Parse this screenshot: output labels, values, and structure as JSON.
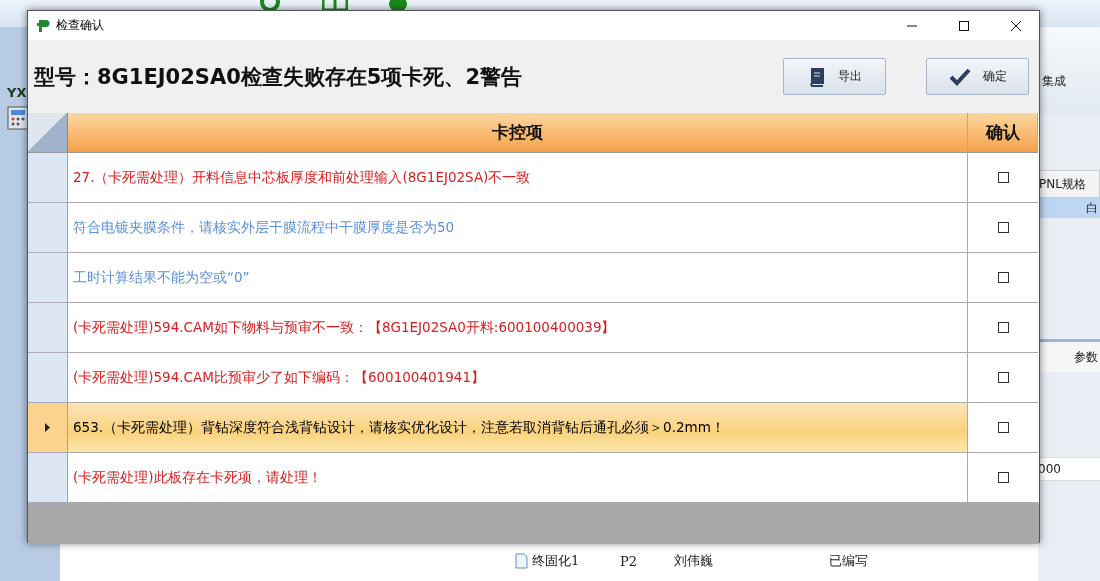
{
  "background": {
    "side_label": "YX",
    "ribbon_button": "集成",
    "column_header": "PNL规格",
    "cell_1": "白",
    "param_header": "参数",
    "cell_2": "000",
    "tree_rows": [
      {
        "name": "终固化1",
        "col_2": "P2",
        "col_3": "刘伟巍",
        "col_4": "已编写"
      }
    ]
  },
  "dialog": {
    "title": "检查确认",
    "heading": "型号：8G1EJ02SA0检查失败存在5项卡死、2警告",
    "buttons": [
      {
        "label": "导出",
        "kind": "export"
      },
      {
        "label": "确定",
        "kind": "confirm"
      }
    ],
    "columns": [
      "卡控项",
      "确认"
    ],
    "rows": [
      {
        "text": "27.（卡死需处理）开料信息中芯板厚度和前处理输入(8G1EJ02SA)不一致",
        "color": "#d42020",
        "selected": false,
        "checked": false
      },
      {
        "text": "符合电镀夹膜条件，请核实外层干膜流程中干膜厚度是否为50",
        "color": "#5b8fd6",
        "selected": false,
        "checked": false
      },
      {
        "text": "工时计算结果不能为空或“0”",
        "color": "#5b8fd6",
        "selected": false,
        "checked": false
      },
      {
        "text": "(卡死需处理)594.CAM如下物料与预审不一致：【8G1EJ02SA0开料:600100400039】",
        "color": "#d42020",
        "selected": false,
        "checked": false
      },
      {
        "text": "(卡死需处理)594.CAM比预审少了如下编码：【600100401941】",
        "color": "#d42020",
        "selected": false,
        "checked": false
      },
      {
        "text": "653.（卡死需处理）背钻深度符合浅背钻设计，请核实优化设计，注意若取消背钻后通孔必须＞0.2mm！",
        "color": "#000000",
        "selected": true,
        "checked": false
      },
      {
        "text": "(卡死需处理)此板存在卡死项，请处理！",
        "color": "#d42020",
        "selected": false,
        "checked": false
      }
    ]
  }
}
